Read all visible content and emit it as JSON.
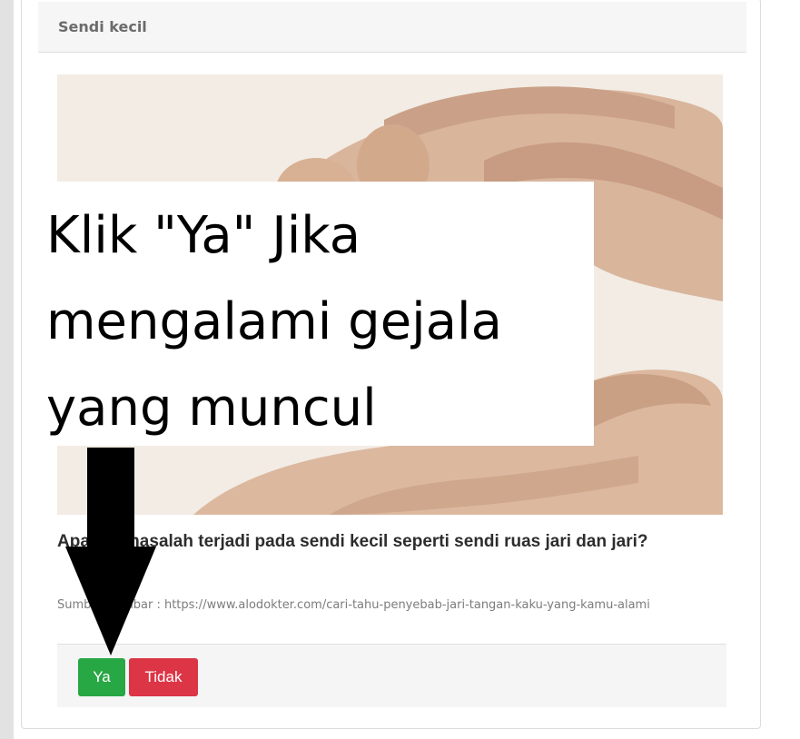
{
  "card": {
    "title": "Sendi kecil"
  },
  "overlay": {
    "text": "Klik \"Ya\" Jika mengalami gejala yang muncul"
  },
  "question": {
    "text": "Apakah masalah terjadi pada sendi kecil seperti sendi ruas jari dan jari?"
  },
  "source": {
    "text": "Sumber gambar : https://www.alodokter.com/cari-tahu-penyebab-jari-tangan-kaku-yang-kamu-alami"
  },
  "buttons": {
    "yes_label": "Ya",
    "no_label": "Tidak"
  },
  "colors": {
    "yes_button": "#28a745",
    "no_button": "#dc3545",
    "annotation_arrow": "#000000"
  },
  "icons": {
    "annotation": "down-arrow-icon",
    "photo": "hands-photo"
  }
}
